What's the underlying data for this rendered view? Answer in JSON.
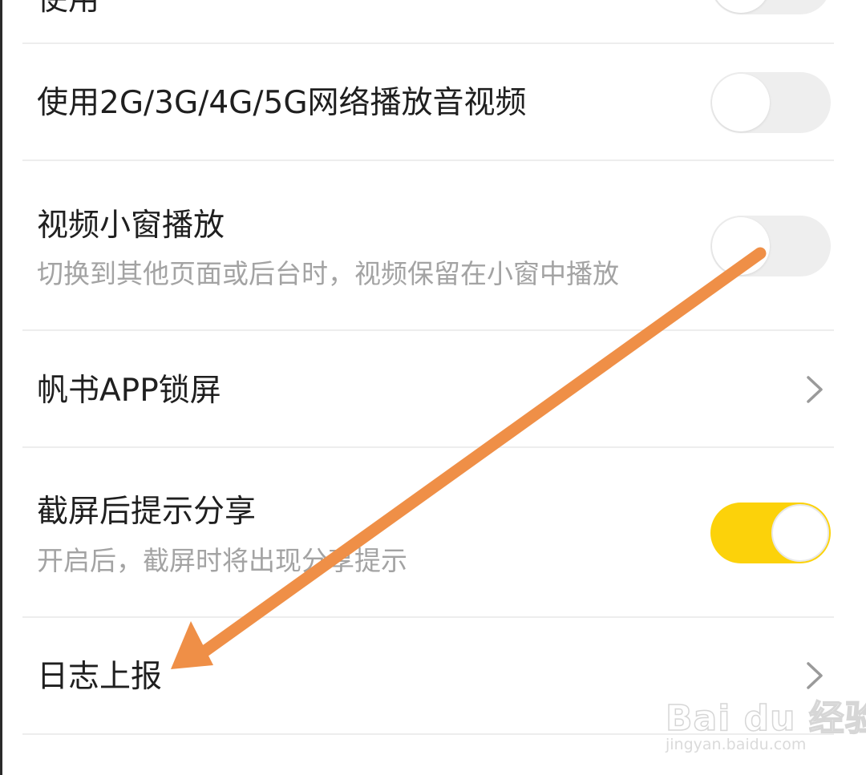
{
  "settings": {
    "top_partial_label": "使用",
    "items": [
      {
        "label": "使用2G/3G/4G/5G网络播放音视频",
        "toggle_on": false
      },
      {
        "label": "视频小窗播放",
        "description": "切换到其他页面或后台时，视频保留在小窗中播放",
        "toggle_on": false
      },
      {
        "label": "帆书APP锁屏"
      },
      {
        "label": "截屏后提示分享",
        "description": "开启后，截屏时将出现分享提示",
        "toggle_on": true
      },
      {
        "label": "日志上报"
      }
    ]
  },
  "annotation": {
    "color": "#ef8f47"
  },
  "watermark": {
    "logo_text": "Bai du 经验",
    "url": "jingyan.baidu.com"
  },
  "colors": {
    "toggle_on": "#fcd20a",
    "toggle_off": "#eeeeee",
    "divider": "#ededed",
    "subtitle": "#a3a3a3"
  }
}
